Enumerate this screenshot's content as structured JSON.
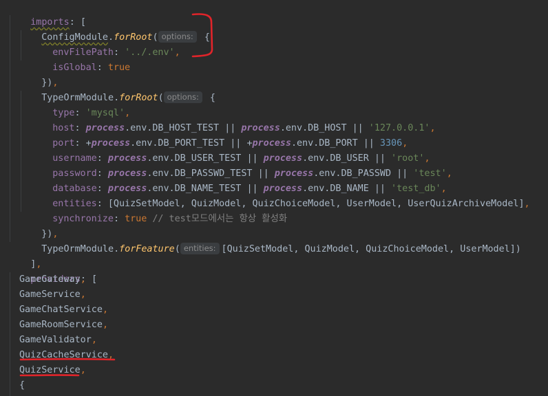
{
  "code": {
    "l1": {
      "key": "imports",
      "colon": ": ",
      "open": "["
    },
    "l2": {
      "cls": "ConfigModule",
      "dot": ".",
      "fn": "forRoot",
      "paren": "(",
      "hint": "options:",
      "brace": " {"
    },
    "l3": {
      "key": "envFilePath",
      "colon": ": ",
      "str": "'../.env'",
      "comma": ","
    },
    "l4": {
      "key": "isGlobal",
      "colon": ": ",
      "kw": "true"
    },
    "l5": {
      "close": "})",
      "comma": ","
    },
    "l6": {
      "cls": "TypeOrmModule",
      "dot": ".",
      "fn": "forRoot",
      "paren": "(",
      "hint": "options:",
      "brace": " {"
    },
    "l7": {
      "key": "type",
      "colon": ": ",
      "str": "'mysql'",
      "comma": ","
    },
    "l8": {
      "key": "host",
      "colon": ": ",
      "p1": "process",
      "e1": ".env.DB_HOST_TEST ",
      "or1": "||",
      "sp": " ",
      "p2": "process",
      "e2": ".env.DB_HOST ",
      "or2": "||",
      "str": " '127.0.0.1'",
      "comma": ","
    },
    "l9": {
      "key": "port",
      "colon": ": ",
      "plus1": "+",
      "p1": "process",
      "e1": ".env.DB_PORT_TEST ",
      "or1": "||",
      "sp": " ",
      "plus2": "+",
      "p2": "process",
      "e2": ".env.DB_PORT ",
      "or2": "||",
      "num": " 3306",
      "comma": ","
    },
    "l10": {
      "key": "username",
      "colon": ": ",
      "p1": "process",
      "e1": ".env.DB_USER_TEST ",
      "or1": "||",
      "sp": " ",
      "p2": "process",
      "e2": ".env.DB_USER ",
      "or2": "||",
      "str": " 'root'",
      "comma": ","
    },
    "l11": {
      "key": "password",
      "colon": ": ",
      "p1": "process",
      "e1": ".env.DB_PASSWD_TEST ",
      "or1": "||",
      "sp": " ",
      "p2": "process",
      "e2": ".env.DB_PASSWD ",
      "or2": "||",
      "str": " 'test'",
      "comma": ","
    },
    "l12": {
      "key": "database",
      "colon": ": ",
      "p1": "process",
      "e1": ".env.DB_NAME_TEST ",
      "or1": "||",
      "sp": " ",
      "p2": "process",
      "e2": ".env.DB_NAME ",
      "or2": "||",
      "str": " 'test_db'",
      "comma": ","
    },
    "l13": {
      "key": "entities",
      "colon": ": ",
      "text": "[QuizSetModel, QuizModel, QuizChoiceModel, UserModel, UserQuizArchiveModel]",
      "comma": ","
    },
    "l14": {
      "key": "synchronize",
      "colon": ": ",
      "kw": "true",
      "cmt": " // test모드에서는 항상 활성화"
    },
    "l15": {
      "close": "})",
      "comma": ","
    },
    "l16": {
      "cls": "TypeOrmModule",
      "dot": ".",
      "fn": "forFeature",
      "paren": "(",
      "hint": "entities:",
      "text": "[QuizSetModel, QuizModel, QuizChoiceModel, UserModel])"
    },
    "l17": {
      "close": "]",
      "comma": ","
    },
    "l18": {
      "key": "providers",
      "colon": ": ",
      "open": "["
    },
    "providers": [
      "GameGateway",
      "GameService",
      "GameChatService",
      "GameRoomService",
      "GameValidator",
      "QuizCacheService",
      "QuizService"
    ],
    "comma": ",",
    "l26": {
      "open": "{"
    }
  },
  "colors": {
    "annotation": "#e0242a",
    "background": "#2b2b2b"
  }
}
